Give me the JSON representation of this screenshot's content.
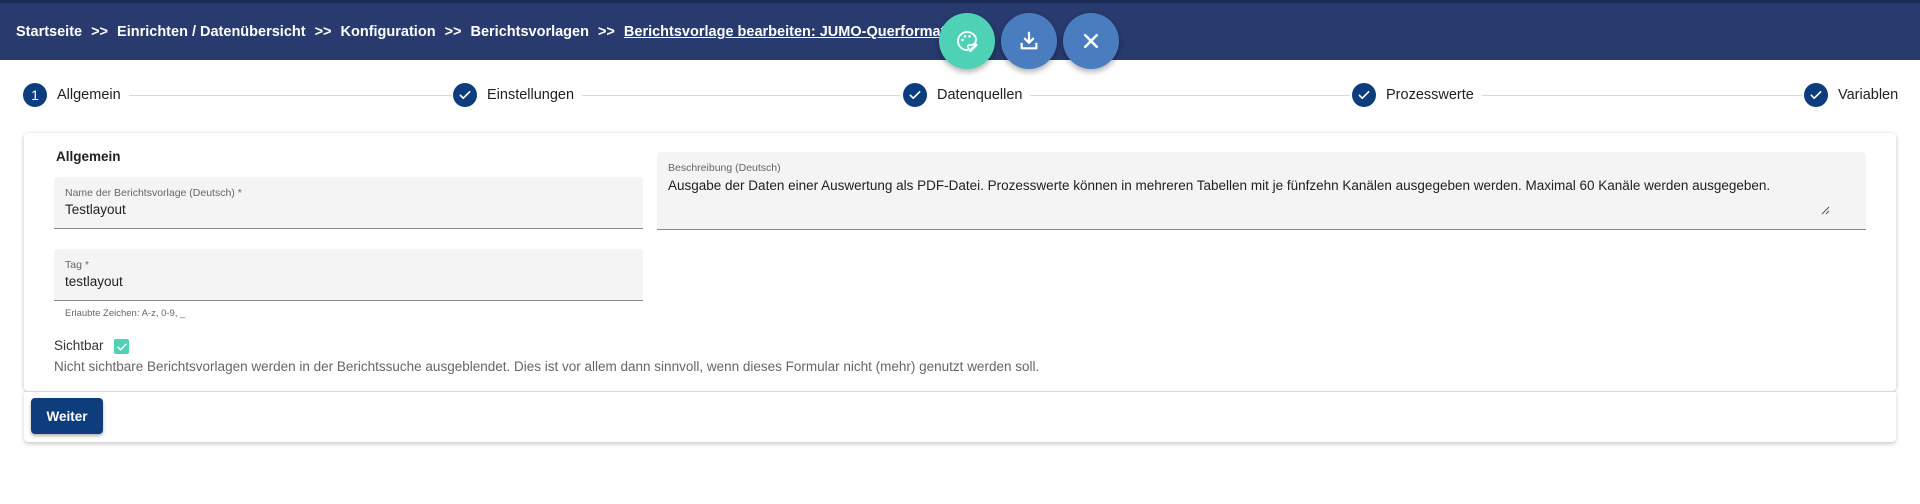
{
  "breadcrumbs": {
    "items": [
      "Startseite",
      "Einrichten / Datenübersicht",
      "Konfiguration",
      "Berichtsvorlagen"
    ],
    "current": "Berichtsvorlage bearbeiten: JUMO-Querformat_1",
    "separator": ">>"
  },
  "actions": {
    "icons": [
      "palette-edit-icon",
      "download-icon",
      "close-icon"
    ],
    "colors": {
      "primary": "#4fd1b5",
      "secondary": "#4a7dbf"
    }
  },
  "stepper": {
    "steps": [
      {
        "number": "1",
        "label": "Allgemein",
        "state": "active"
      },
      {
        "label": "Einstellungen",
        "state": "done"
      },
      {
        "label": "Datenquellen",
        "state": "done"
      },
      {
        "label": "Prozesswerte",
        "state": "done"
      },
      {
        "label": "Variablen",
        "state": "done"
      }
    ]
  },
  "form": {
    "section_title": "Allgemein",
    "name": {
      "label": "Name der Berichtsvorlage (Deutsch) *",
      "value": "Testlayout"
    },
    "tag": {
      "label": "Tag *",
      "value": "testlayout",
      "hint": "Erlaubte Zeichen: A-z, 0-9, _"
    },
    "description": {
      "label": "Beschreibung (Deutsch)",
      "value": "Ausgabe der Daten einer Auswertung als PDF-Datei. Prozesswerte können in mehreren Tabellen mit je fünfzehn Kanälen ausgegeben werden. Maximal 60 Kanäle werden ausgegeben."
    },
    "visible": {
      "label": "Sichtbar",
      "checked": true,
      "description": "Nicht sichtbare Berichtsvorlagen werden in der Berichtssuche ausgeblendet. Dies ist vor allem dann sinnvoll, wenn dieses Formular nicht (mehr) genutzt werden soll."
    }
  },
  "footer": {
    "next_label": "Weiter"
  },
  "theme": {
    "header_bg": "#283a6e",
    "primary": "#0d3d7d",
    "accent": "#4fd1b5"
  }
}
